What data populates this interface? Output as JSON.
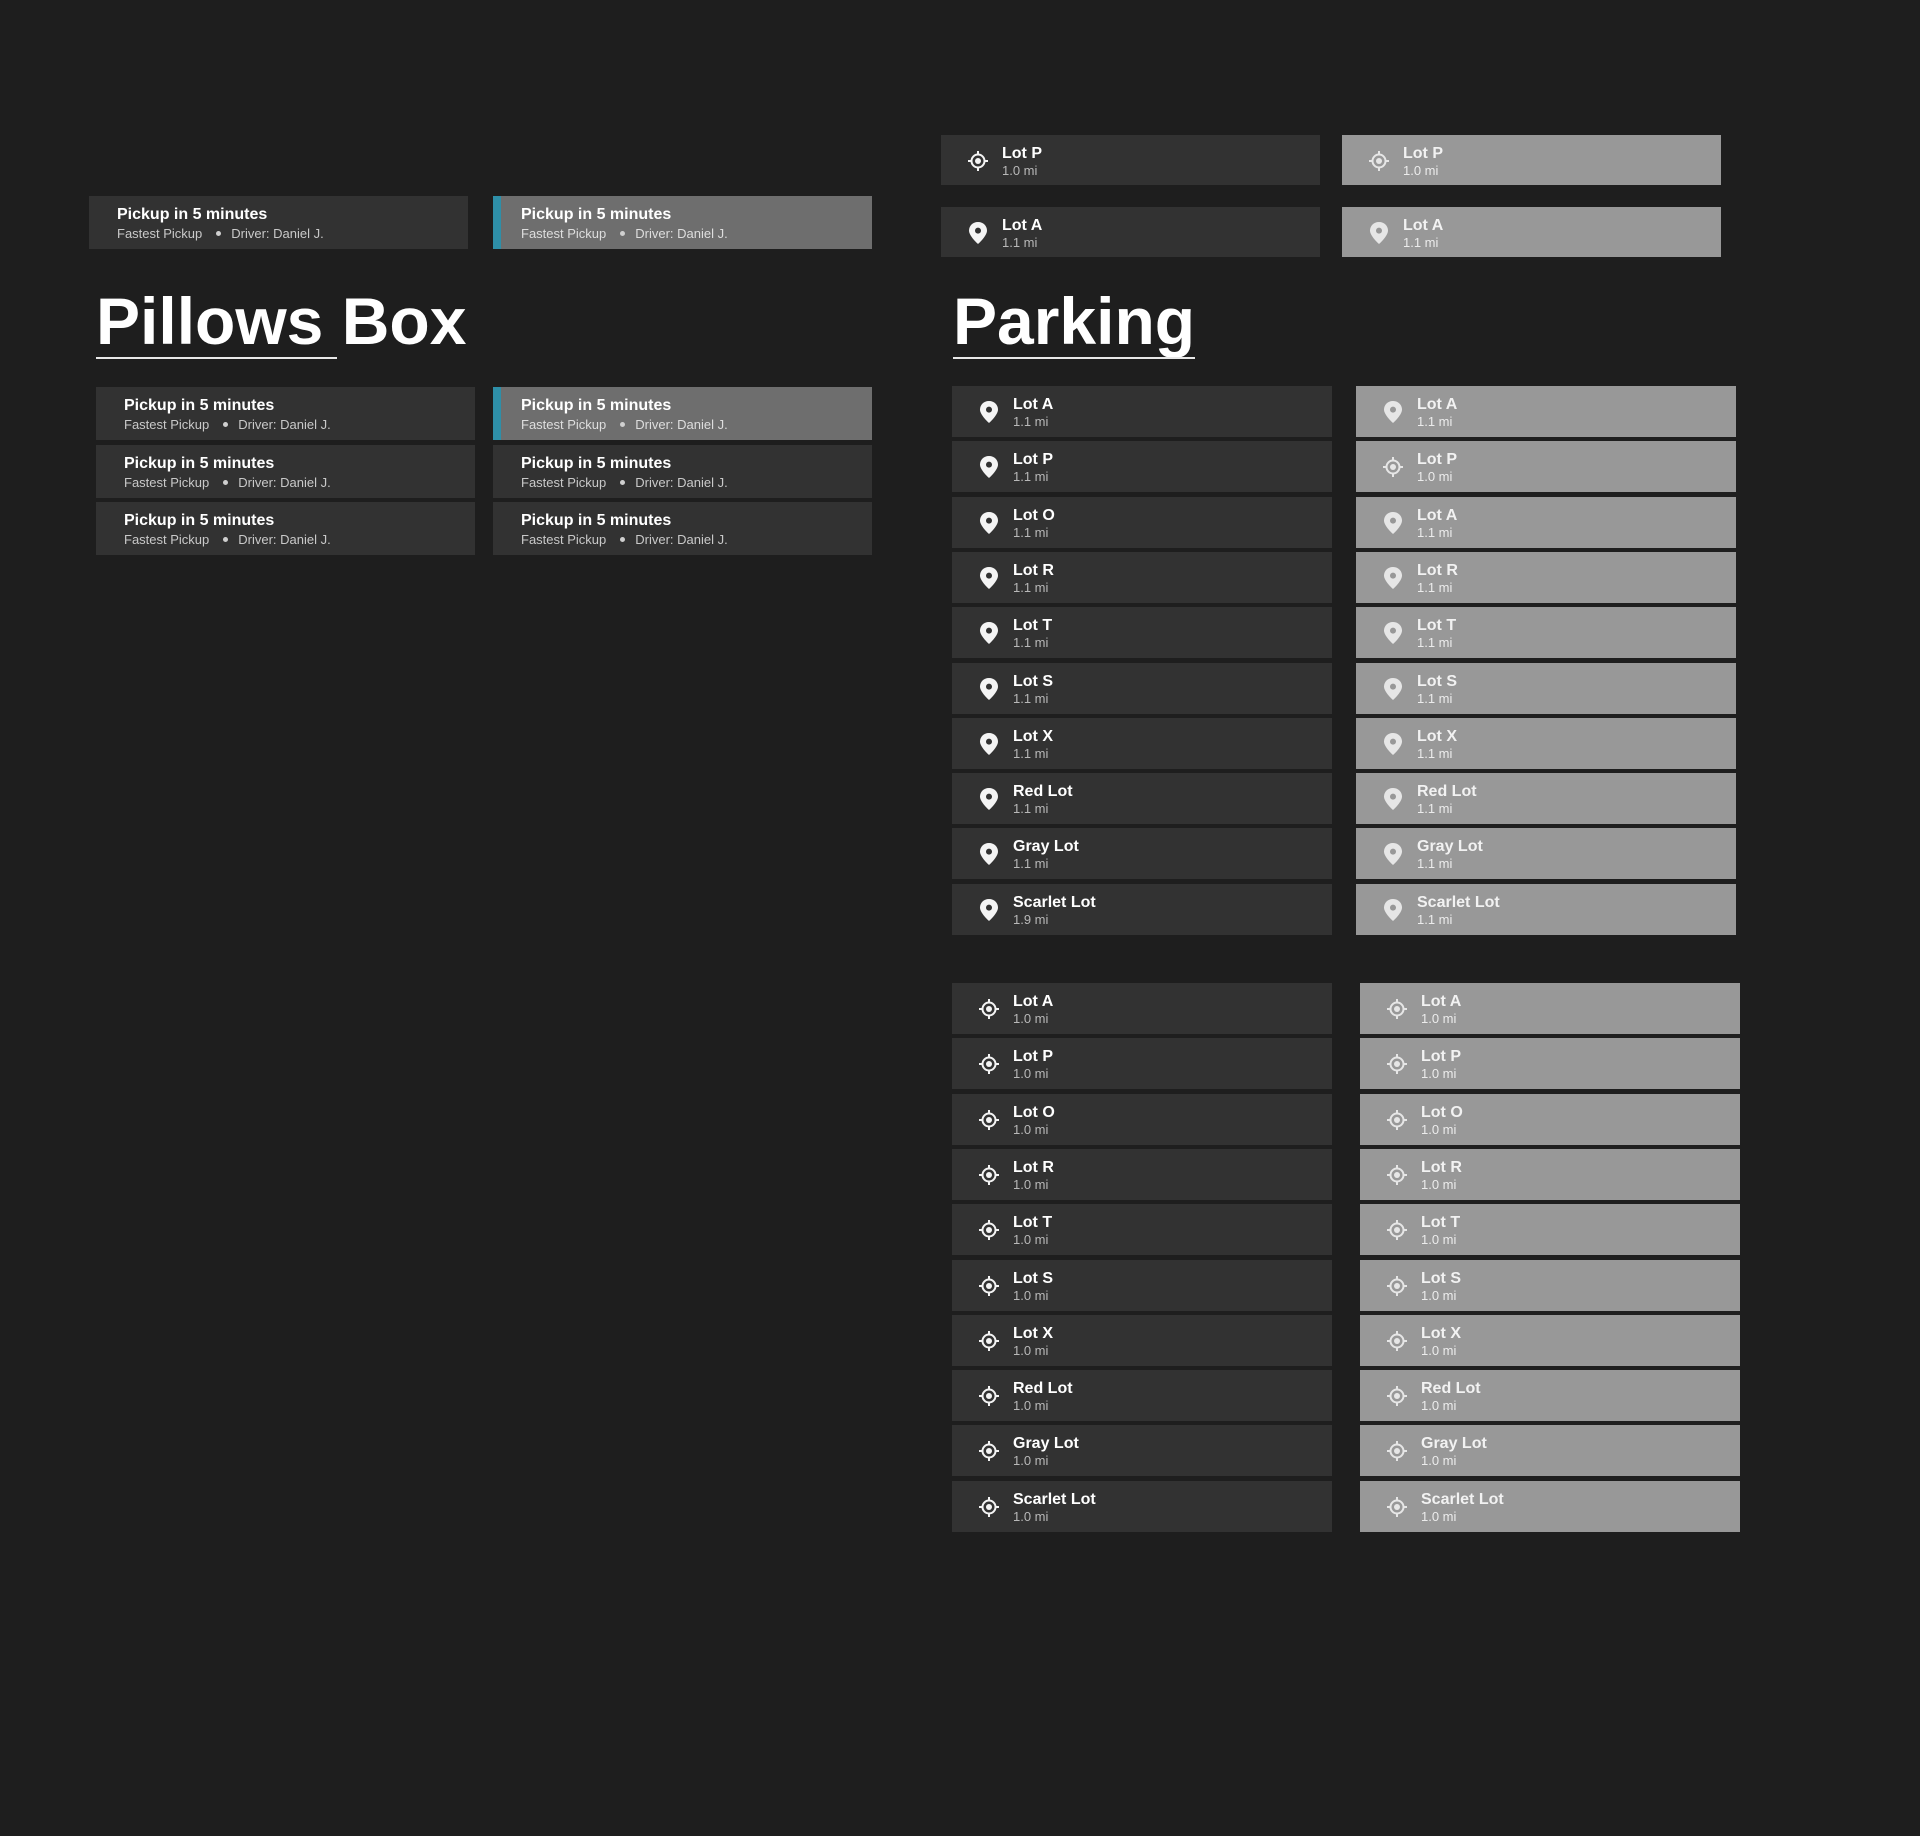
{
  "pickup": {
    "title": "Pickup in 5 minutes",
    "subtitle": "Fastest Pickup",
    "driver": "Driver: Daniel J."
  },
  "headings": {
    "pillows": "Pillows Box",
    "parking": "Parking"
  },
  "colors": {
    "background": "#1e1e1e",
    "card_dark": "#323232",
    "card_light": "#989898",
    "card_selected": "#6e6e6e",
    "accent": "#2e8fa8"
  },
  "top_lots": [
    {
      "name": "Lot P",
      "distance": "1.0 mi",
      "icon": "locate-target-icon"
    },
    {
      "name": "Lot A",
      "distance": "1.1 mi",
      "icon": "map-pin-icon"
    }
  ],
  "pin_lots_dark": [
    {
      "name": "Lot A",
      "distance": "1.1 mi"
    },
    {
      "name": "Lot P",
      "distance": "1.1 mi"
    },
    {
      "name": "Lot O",
      "distance": "1.1 mi"
    },
    {
      "name": "Lot R",
      "distance": "1.1 mi"
    },
    {
      "name": "Lot T",
      "distance": "1.1 mi"
    },
    {
      "name": "Lot S",
      "distance": "1.1 mi"
    },
    {
      "name": "Lot X",
      "distance": "1.1 mi"
    },
    {
      "name": "Red Lot",
      "distance": "1.1 mi"
    },
    {
      "name": "Gray Lot",
      "distance": "1.1 mi"
    },
    {
      "name": "Scarlet Lot",
      "distance": "1.9 mi"
    }
  ],
  "pin_lots_light": [
    {
      "name": "Lot A",
      "distance": "1.1 mi",
      "icon": "map-pin-icon"
    },
    {
      "name": "Lot P",
      "distance": "1.0 mi",
      "icon": "locate-target-icon"
    },
    {
      "name": "Lot A",
      "distance": "1.1 mi",
      "icon": "map-pin-icon"
    },
    {
      "name": "Lot R",
      "distance": "1.1 mi",
      "icon": "map-pin-icon"
    },
    {
      "name": "Lot T",
      "distance": "1.1 mi",
      "icon": "map-pin-icon"
    },
    {
      "name": "Lot S",
      "distance": "1.1 mi",
      "icon": "map-pin-icon"
    },
    {
      "name": "Lot X",
      "distance": "1.1 mi",
      "icon": "map-pin-icon"
    },
    {
      "name": "Red Lot",
      "distance": "1.1 mi",
      "icon": "map-pin-icon"
    },
    {
      "name": "Gray Lot",
      "distance": "1.1 mi",
      "icon": "map-pin-icon"
    },
    {
      "name": "Scarlet Lot",
      "distance": "1.1 mi",
      "icon": "map-pin-icon"
    }
  ],
  "target_lots": [
    {
      "name": "Lot A",
      "distance": "1.0 mi"
    },
    {
      "name": "Lot P",
      "distance": "1.0 mi"
    },
    {
      "name": "Lot O",
      "distance": "1.0 mi"
    },
    {
      "name": "Lot R",
      "distance": "1.0 mi"
    },
    {
      "name": "Lot T",
      "distance": "1.0 mi"
    },
    {
      "name": "Lot S",
      "distance": "1.0 mi"
    },
    {
      "name": "Lot X",
      "distance": "1.0 mi"
    },
    {
      "name": "Red Lot",
      "distance": "1.0 mi"
    },
    {
      "name": "Gray Lot",
      "distance": "1.0 mi"
    },
    {
      "name": "Scarlet Lot",
      "distance": "1.0 mi"
    }
  ]
}
